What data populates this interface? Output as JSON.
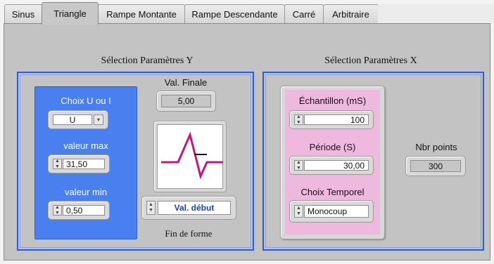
{
  "tabs": [
    {
      "label": "Sinus",
      "active": false
    },
    {
      "label": "Triangle",
      "active": true
    },
    {
      "label": "Rampe Montante",
      "active": false
    },
    {
      "label": "Rampe Descendante",
      "active": false
    },
    {
      "label": "Carré",
      "active": false
    },
    {
      "label": "Arbitraire",
      "active": false
    }
  ],
  "y_section": {
    "title": "Sélection Paramètres Y",
    "choix_label": "Choix U ou I",
    "choix_value": "U",
    "valeur_max_label": "valeur max",
    "valeur_max": "31,50",
    "valeur_min_label": "valeur min",
    "valeur_min": "0,50",
    "val_finale_label": "Val. Finale",
    "val_finale": "5,00",
    "fin_forme_value": "Val. début",
    "fin_forme_label": "Fin de forme"
  },
  "x_section": {
    "title": "Sélection Paramètres X",
    "echantillon_label": "Échantillon (mS)",
    "echantillon": "100",
    "periode_label": "Période (S)",
    "periode": "30,00",
    "choix_temporel_label": "Choix Temporel",
    "choix_temporel": "Monocoup",
    "nbr_points_label": "Nbr points",
    "nbr_points": "300"
  },
  "colors": {
    "blue_panel": "#4a7ff0",
    "pink_panel": "#efb9df",
    "frame_blue": "#2d5bd8",
    "waveform": "#c8157f"
  },
  "icons": {
    "spin": "up-down-spinner-icon",
    "dropdown": "dropdown-arrow-icon",
    "waveform": "triangle-waveform-icon"
  }
}
